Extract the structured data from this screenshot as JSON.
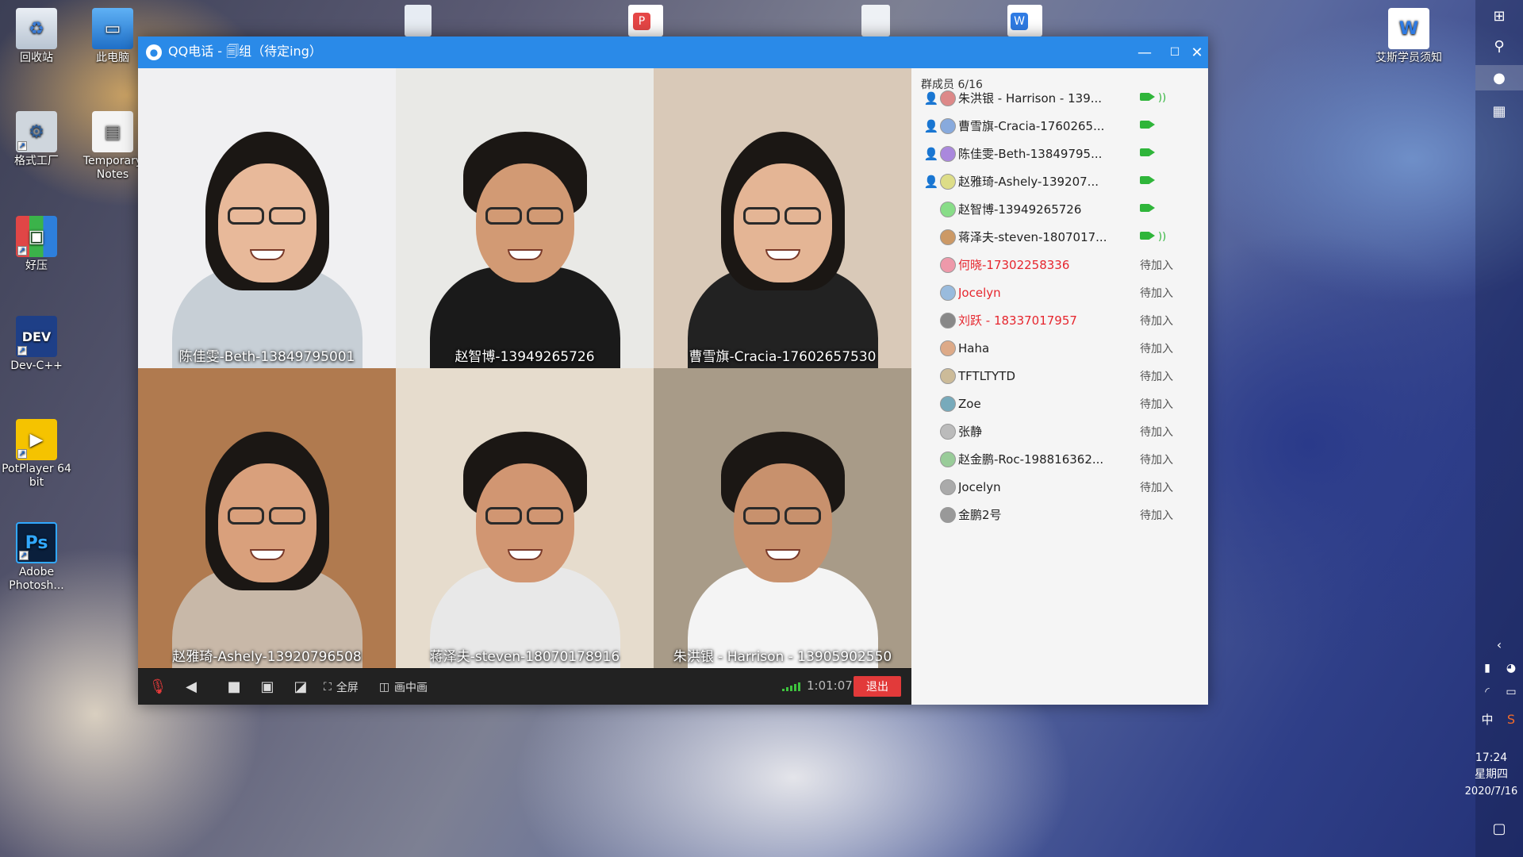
{
  "desktop": {
    "icons": [
      {
        "label": "回收站",
        "icon": "recycle-bin-icon"
      },
      {
        "label": "此电脑",
        "icon": "computer-icon"
      },
      {
        "label": "格式工厂",
        "icon": "format-factory-icon"
      },
      {
        "label": "Temporary Notes",
        "icon": "document-icon"
      },
      {
        "label": "好压",
        "icon": "archive-icon"
      },
      {
        "label": "Dev-C++",
        "icon": "dev-cpp-icon"
      },
      {
        "label": "PotPlayer 64 bit",
        "icon": "potplayer-icon"
      },
      {
        "label": "Adobe Photosh...",
        "icon": "photoshop-icon"
      },
      {
        "label": "艾斯学员须知",
        "icon": "word-document-icon"
      }
    ]
  },
  "window": {
    "title": "QQ电话 - 🗐组（待定ing）",
    "minimize": "—",
    "maximize": "☐",
    "close": "✕"
  },
  "videos": [
    {
      "name": "陈佳雯-Beth-13849795001",
      "bg": "#f0f0f2",
      "shirt": "#c7cfd6",
      "skin": "#e8b99a"
    },
    {
      "name": "赵智博-13949265726",
      "bg": "#e9e9e6",
      "shirt": "#1a1a1a",
      "skin": "#d29a74"
    },
    {
      "name": "曹雪旗-Cracia-17602657530",
      "bg": "#d9c9b8",
      "shirt": "#222222",
      "skin": "#e4b595"
    },
    {
      "name": "赵雅琦-Ashely-13920796508",
      "bg": "#b07a4f",
      "shirt": "#c8b8a8",
      "skin": "#d9a07c"
    },
    {
      "name": "蒋泽夫-steven-18070178916",
      "bg": "#e6dccd",
      "shirt": "#e8e8e8",
      "skin": "#d19672"
    },
    {
      "name": "朱洪银 - Harrison - 13905902550",
      "bg": "#a89b88",
      "shirt": "#f4f4f4",
      "skin": "#c8916d"
    }
  ],
  "controls": {
    "fullscreen_label": "全屏",
    "pip_label": "画中画",
    "timer": "1:01:07",
    "exit_label": "退出"
  },
  "members": {
    "header": "群成员 6/16",
    "list": [
      {
        "name": "朱洪银 - Harrison - 139...",
        "host": true,
        "state": "video-audio",
        "red": false
      },
      {
        "name": "曹雪旗-Cracia-1760265...",
        "host": true,
        "state": "video",
        "red": false
      },
      {
        "name": "陈佳雯-Beth-13849795\u0000...",
        "host": true,
        "state": "video",
        "red": false
      },
      {
        "name": "赵雅琦-Ashely-139207\u0000...",
        "host": true,
        "state": "video",
        "red": false
      },
      {
        "name": "赵智博-13949265726",
        "host": false,
        "state": "video",
        "red": false
      },
      {
        "name": "蒋泽夫-steven-1807017...",
        "host": false,
        "state": "video-audio",
        "red": false
      },
      {
        "name": "何晓-17302258336",
        "host": false,
        "state": "pending",
        "red": true
      },
      {
        "name": "Jocelyn",
        "host": false,
        "state": "pending",
        "red": true
      },
      {
        "name": "刘跃 - 18337017957",
        "host": false,
        "state": "pending",
        "red": true
      },
      {
        "name": "Haha",
        "host": false,
        "state": "pending",
        "red": false
      },
      {
        "name": "TFTLTYTD",
        "host": false,
        "state": "pending",
        "red": false
      },
      {
        "name": "Zoe",
        "host": false,
        "state": "pending",
        "red": false
      },
      {
        "name": "张静",
        "host": false,
        "state": "pending",
        "red": false
      },
      {
        "name": "赵金鹏-Roc-198816362...",
        "host": false,
        "state": "pending",
        "red": false
      },
      {
        "name": "Jocelyn",
        "host": false,
        "state": "pending",
        "red": false
      },
      {
        "name": "金鹏2号",
        "host": false,
        "state": "pending",
        "red": false
      }
    ],
    "pending_label": "待加入"
  },
  "taskbar": {
    "ime": "中",
    "time": "17:24",
    "weekday": "星期四",
    "date": "2020/7/16"
  }
}
